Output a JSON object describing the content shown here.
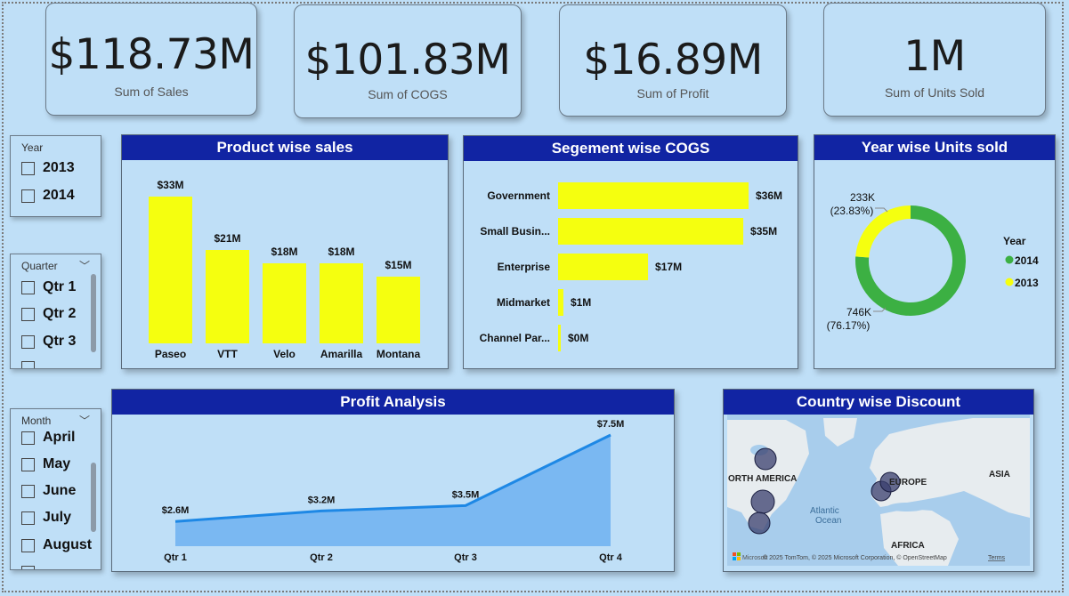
{
  "kpis": [
    {
      "value": "$118.73M",
      "label": "Sum of  Sales"
    },
    {
      "value": "$101.83M",
      "label": "Sum of COGS"
    },
    {
      "value": "$16.89M",
      "label": "Sum of Profit"
    },
    {
      "value": "1M",
      "label": "Sum of Units Sold"
    }
  ],
  "slicers": {
    "year": {
      "title": "Year",
      "items": [
        "2013",
        "2014"
      ]
    },
    "quarter": {
      "title": "Quarter",
      "items": [
        "Qtr 1",
        "Qtr 2",
        "Qtr 3"
      ]
    },
    "month": {
      "title": "Month",
      "items": [
        "April",
        "May",
        "June",
        "July",
        "August"
      ]
    }
  },
  "icons": {
    "dropdown": "chevron-down-icon",
    "checkbox": "checkbox-icon"
  },
  "colors": {
    "title_bar": "#1124a3",
    "bar": "#f5ff0f",
    "area_line": "#1e88e5",
    "area_fill": "#7ab8f2",
    "donut_2014": "#3cb043",
    "donut_2013": "#f5ff0f",
    "bubble": "#3a3f6e"
  },
  "chart_data": [
    {
      "id": "product",
      "type": "bar",
      "title": "Product wise sales",
      "categories": [
        "Paseo",
        "VTT",
        "Velo",
        "Amarilla",
        "Montana"
      ],
      "values": [
        33,
        21,
        18,
        18,
        15
      ],
      "labels": [
        "$33M",
        "$21M",
        "$18M",
        "$18M",
        "$15M"
      ],
      "ylim": [
        0,
        36
      ]
    },
    {
      "id": "segment",
      "type": "bar",
      "orientation": "horizontal",
      "title": "Segement wise COGS",
      "categories": [
        "Government",
        "Small Busin...",
        "Enterprise",
        "Midmarket",
        "Channel Par..."
      ],
      "values": [
        36,
        35,
        17,
        1,
        0.2
      ],
      "labels": [
        "$36M",
        "$35M",
        "$17M",
        "$1M",
        "$0M"
      ],
      "xlim": [
        0,
        40
      ]
    },
    {
      "id": "units",
      "type": "pie",
      "title": "Year wise Units sold",
      "legend_title": "Year",
      "legend_position": "right",
      "slices": [
        {
          "name": "2014",
          "value": 746,
          "percent": 76.17,
          "label": "746K",
          "pct_label": "(76.17%)"
        },
        {
          "name": "2013",
          "value": 233,
          "percent": 23.83,
          "label": "233K",
          "pct_label": "(23.83%)"
        }
      ]
    },
    {
      "id": "profit",
      "type": "area",
      "title": "Profit Analysis",
      "categories": [
        "Qtr 1",
        "Qtr 2",
        "Qtr 3",
        "Qtr 4"
      ],
      "values": [
        2.6,
        3.2,
        3.5,
        7.5
      ],
      "labels": [
        "$2.6M",
        "$3.2M",
        "$3.5M",
        "$7.5M"
      ],
      "ylim": [
        0,
        7.5
      ]
    }
  ],
  "map": {
    "title": "Country wise Discount",
    "labels": {
      "north_america": "ORTH AMERICA",
      "europe": "EUROPE",
      "asia": "ASIA",
      "africa": "AFRICA",
      "ocean_1": "Atlantic",
      "ocean_2": "Ocean"
    },
    "attribution": "© 2025 TomTom, © 2025 Microsoft Corporation, © OpenStreetMap",
    "terms": "Terms",
    "logo_text": "Microsoft"
  }
}
